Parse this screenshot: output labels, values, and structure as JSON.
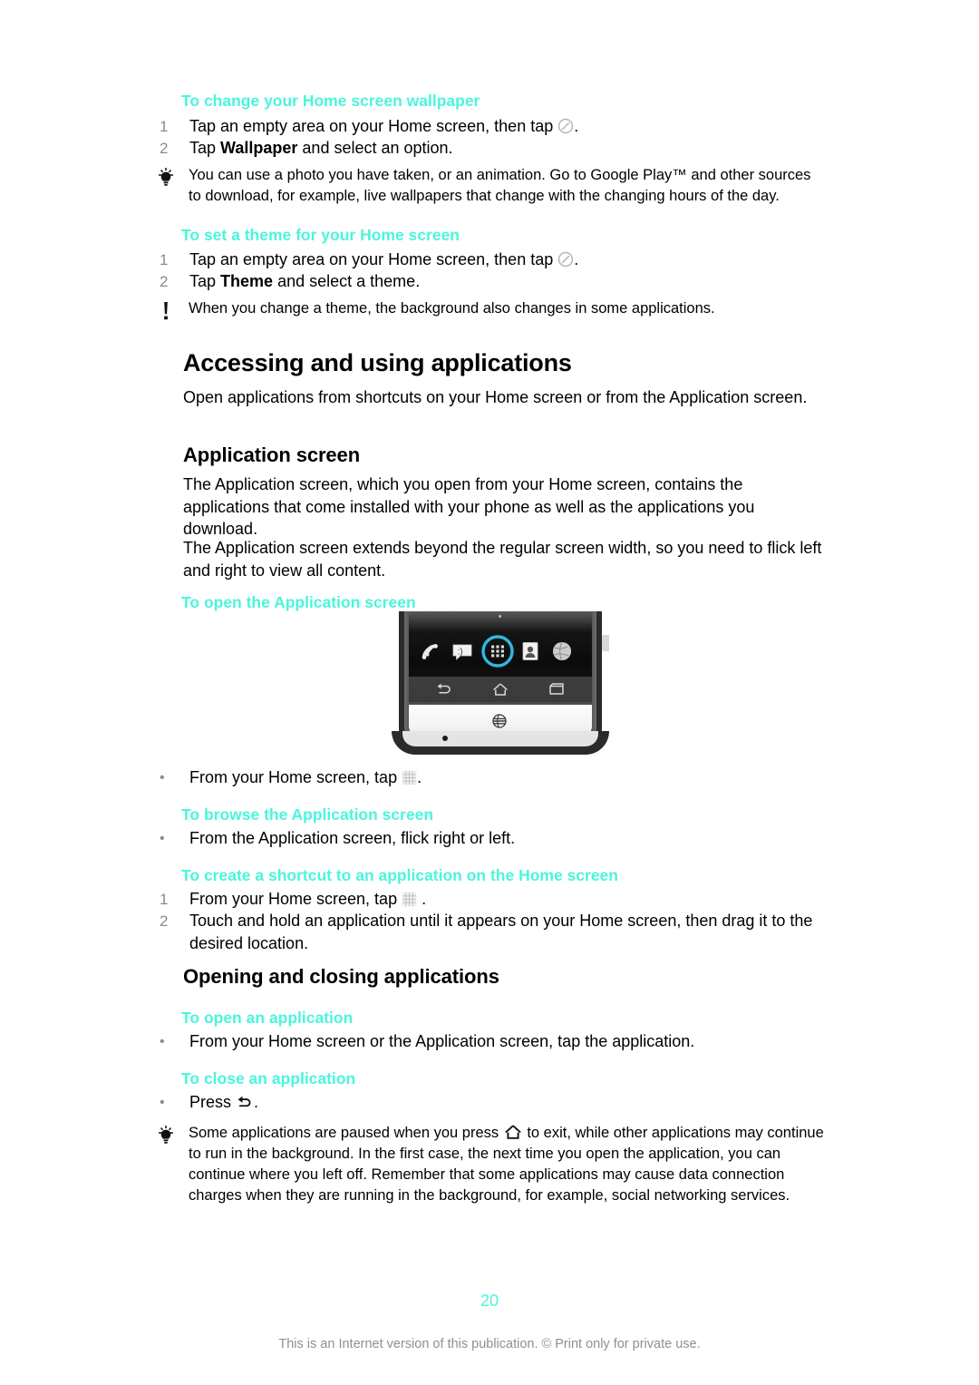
{
  "document": {
    "page_number": "20",
    "footer_note": "This is an Internet version of this publication. © Print only for private use.",
    "heading_color": "#4bf5dc"
  },
  "sections": {
    "change_wallpaper": {
      "heading": "To change your Home screen wallpaper",
      "steps": [
        {
          "number": "1",
          "text_before": "Tap an empty area on your Home screen, then tap",
          "icon": "circle-slash-icon",
          "text_after": "."
        },
        {
          "number": "2",
          "text_before": "Tap",
          "bold": "Wallpaper",
          "text_after": "and select an option."
        }
      ],
      "tip": {
        "icon": "lightbulb-icon",
        "text": "You can use a photo you have taken, or an animation. Go to Google Play™ and other sources to download, for example, live wallpapers that change with the changing hours of the day."
      }
    },
    "set_theme": {
      "heading": "To set a theme for your Home screen",
      "steps": [
        {
          "number": "1",
          "text_before": "Tap an empty area on your Home screen, then tap",
          "icon": "circle-slash-icon",
          "text_after": "."
        },
        {
          "number": "2",
          "text_before": "Tap",
          "bold": "Theme",
          "text_after": "and select a theme."
        }
      ],
      "note": {
        "icon": "exclamation-icon",
        "text": "When you change a theme, the background also changes in some applications."
      }
    },
    "accessing_using": {
      "title": "Accessing and using applications",
      "intro": "Open applications from shortcuts on your Home screen or from the Application screen."
    },
    "application_screen": {
      "title": "Application screen",
      "paragraphs": [
        "The Application screen, which you open from your Home screen, contains the applications that come installed with your phone as well as the applications you download.",
        "The Application screen extends beyond the regular screen width, so you need to flick left and right to view all content."
      ],
      "open_heading": "To open the Application screen",
      "open_bullet": {
        "bullet": "•",
        "text_before": "From your Home screen, tap",
        "icon": "app-grid-icon",
        "text_after": "."
      },
      "browse_heading": "To browse the Application screen",
      "browse_bullet": {
        "bullet": "•",
        "text": "From the Application screen, flick right or left."
      },
      "shortcut_heading": "To create a shortcut to an application on the Home screen",
      "shortcut_steps": [
        {
          "number": "1",
          "text_before": "From your Home screen, tap",
          "icon": "app-grid-icon",
          "text_after": "."
        },
        {
          "number": "2",
          "text": "Touch and hold an application until it appears on your Home screen, then drag it to the desired location."
        }
      ]
    },
    "opening_closing": {
      "title": "Opening and closing applications",
      "open_heading": "To open an application",
      "open_bullet": {
        "bullet": "•",
        "text": "From your Home screen or the Application screen, tap the application."
      },
      "close_heading": "To close an application",
      "close_bullet": {
        "bullet": "•",
        "text_before": "Press",
        "icon": "back-arrow-icon",
        "text_after": "."
      },
      "tip": {
        "icon": "lightbulb-icon",
        "text_before": "Some applications are paused when you press",
        "icon_inline": "home-icon",
        "text_after": "to exit, while other applications may continue to run in the background. In the first case, the next time you open the application, you can continue where you left off. Remember that some applications may cause data connection charges when they are running in the background, for example, social networking services."
      }
    }
  },
  "phone_illustration": {
    "name": "android-phone-bottom-mockup",
    "highlight_color": "#2fb8e0",
    "dock_icons": [
      {
        "name": "phone-handset-icon",
        "label": "Phone"
      },
      {
        "name": "messaging-icon",
        "label": "Messaging"
      },
      {
        "name": "app-grid-icon",
        "label": "Application screen",
        "highlighted": "true"
      },
      {
        "name": "contacts-icon",
        "label": "Contacts"
      },
      {
        "name": "browser-globe-icon",
        "label": "Browser"
      }
    ],
    "nav_icons": [
      {
        "name": "back-arrow-icon",
        "label": "Back"
      },
      {
        "name": "home-icon",
        "label": "Home"
      },
      {
        "name": "recent-apps-icon",
        "label": "Recent apps"
      }
    ],
    "carrier_logo": "att-globe-logo"
  }
}
